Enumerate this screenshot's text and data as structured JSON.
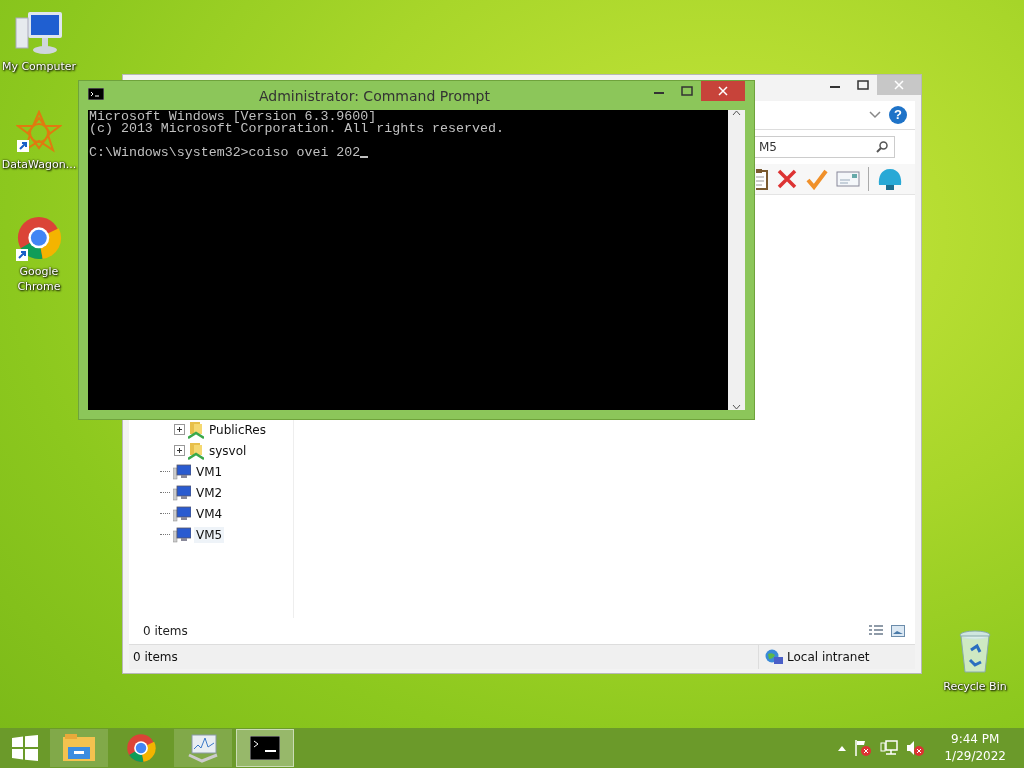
{
  "desktop_icons": [
    {
      "label": "My Computer",
      "kind": "computer"
    },
    {
      "label": "DataWagon...",
      "kind": "star"
    },
    {
      "label": "Google Chrome",
      "kind": "chrome"
    },
    {
      "label": "Recycle Bin",
      "kind": "bin"
    }
  ],
  "explorer": {
    "help_label": "?",
    "search_value": "M5",
    "tree": [
      {
        "label": "PublicRes",
        "kind": "share",
        "expanded": false,
        "selected": false
      },
      {
        "label": "sysvol",
        "kind": "share",
        "expanded": false,
        "selected": false
      },
      {
        "label": "VM1",
        "kind": "computer",
        "selected": false
      },
      {
        "label": "VM2",
        "kind": "computer",
        "selected": false
      },
      {
        "label": "VM4",
        "kind": "computer",
        "selected": false
      },
      {
        "label": "VM5",
        "kind": "computer",
        "selected": true
      }
    ],
    "content_status": "0 items",
    "status_bar": {
      "items": "0 items",
      "zone": "Local intranet"
    }
  },
  "console": {
    "title": "Administrator: Command Prompt",
    "lines": [
      "Microsoft Windows [Version 6.3.9600]",
      "(c) 2013 Microsoft Corporation. All rights reserved."
    ],
    "prompt": "C:\\Windows\\system32>coiso ovei 202"
  },
  "taskbar": {
    "apps": [
      {
        "kind": "explorer",
        "selected": false
      },
      {
        "kind": "chrome",
        "selected": false
      },
      {
        "kind": "monitor",
        "selected": false
      },
      {
        "kind": "console",
        "selected": true
      }
    ],
    "clock": {
      "time": "9:44 PM",
      "date": "1/29/2022"
    }
  }
}
